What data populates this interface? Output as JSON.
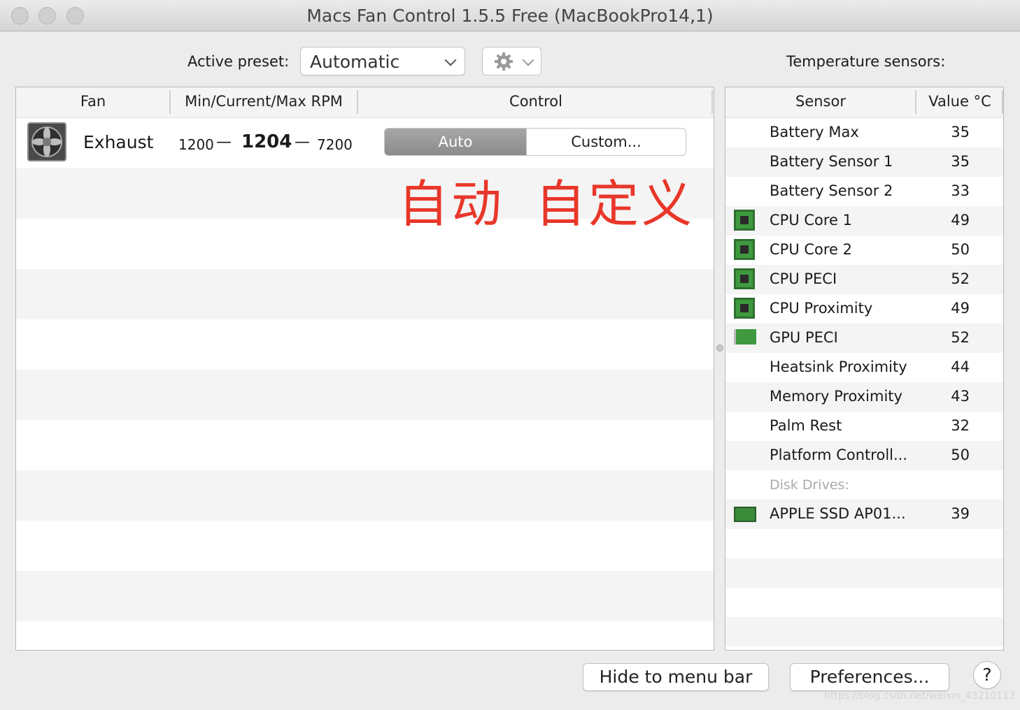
{
  "window": {
    "title": "Macs Fan Control 1.5.5 Free (MacBookPro14,1)"
  },
  "preset": {
    "label": "Active preset:",
    "value": "Automatic"
  },
  "sensors_label": "Temperature sensors:",
  "fan_table": {
    "headers": [
      "Fan",
      "Min/Current/Max RPM",
      "Control"
    ],
    "rows": [
      {
        "name": "Exhaust",
        "min": "1200",
        "current": "1204",
        "max": "7200",
        "dash": "—",
        "control_auto": "Auto",
        "control_custom": "Custom..."
      }
    ]
  },
  "annotation": {
    "auto": "自动",
    "custom": "自定义",
    "color": "#e8372a"
  },
  "sensor_table": {
    "headers": [
      "Sensor",
      "Value °C"
    ],
    "rows": [
      {
        "name": "Battery Max",
        "value": "35",
        "icon": ""
      },
      {
        "name": "Battery Sensor 1",
        "value": "35",
        "icon": ""
      },
      {
        "name": "Battery Sensor 2",
        "value": "33",
        "icon": ""
      },
      {
        "name": "CPU Core 1",
        "value": "49",
        "icon": "cpu-chip-icon"
      },
      {
        "name": "CPU Core 2",
        "value": "50",
        "icon": "cpu-chip-icon"
      },
      {
        "name": "CPU PECI",
        "value": "52",
        "icon": "cpu-chip-icon"
      },
      {
        "name": "CPU Proximity",
        "value": "49",
        "icon": "cpu-chip-icon"
      },
      {
        "name": "GPU PECI",
        "value": "52",
        "icon": "gpu-card-icon"
      },
      {
        "name": "Heatsink Proximity",
        "value": "44",
        "icon": ""
      },
      {
        "name": "Memory Proximity",
        "value": "43",
        "icon": ""
      },
      {
        "name": "Palm Rest",
        "value": "32",
        "icon": ""
      },
      {
        "name": "Platform Controll...",
        "value": "50",
        "icon": ""
      }
    ],
    "disk_section_label": "Disk Drives:",
    "disk_rows": [
      {
        "name": "APPLE SSD AP01...",
        "value": "39",
        "icon": "ssd-icon"
      }
    ]
  },
  "buttons": {
    "hide": "Hide to menu bar",
    "preferences": "Preferences...",
    "help": "?"
  },
  "watermark": "https://blog.csdn.net/weixin_43210113"
}
